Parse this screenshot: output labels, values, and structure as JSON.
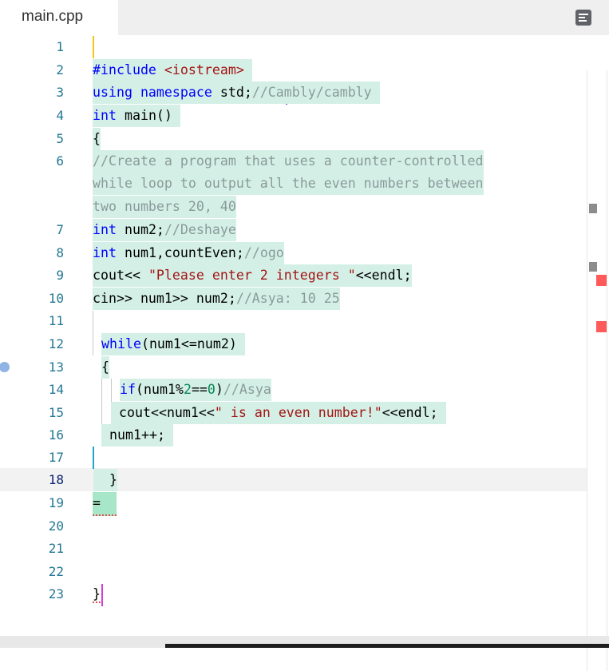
{
  "tab": {
    "title": "main.cpp"
  },
  "gutter": {
    "numbers": [
      "1",
      "2",
      "3",
      "4",
      "5",
      "6",
      "7",
      "8",
      "9",
      "10",
      "11",
      "12",
      "13",
      "14",
      "15",
      "16",
      "17",
      "18",
      "19",
      "20",
      "21",
      "22",
      "23"
    ],
    "active_line": "18"
  },
  "code": {
    "l2_a": "#include ",
    "l2_b": "<iostream>",
    "l3_a": "using namespace",
    "l3_b": " std;",
    "l3_c": "//Cambly/cambly",
    "l4_a": "int",
    "l4_b": " main()",
    "l5": "{",
    "l6_1": "//Create a program that uses a counter-controlled",
    "l6_2": "while loop to output all the even numbers between",
    "l6_3": "two numbers 20, 40",
    "l7_a": "int",
    "l7_b": " num2;",
    "l7_c": "//Deshaye",
    "l8_a": "int",
    "l8_b": " num1,countEven;",
    "l8_c": "//ogo",
    "l9_a": "cout<< ",
    "l9_b": "\"Please enter 2 integers \"",
    "l9_c": "<<endl;",
    "l10_a": "cin>> num1>> num2;",
    "l10_b": "//Asya: 10 25",
    "l12_a": "while",
    "l12_b": "(num1<=num2)",
    "l13": "{",
    "l14_a": "if",
    "l14_b": "(num1%",
    "l14_c": "2",
    "l14_d": "==",
    "l14_e": "0",
    "l14_f": ")",
    "l14_g": "//Asya",
    "l15_a": "cout<<num1<<",
    "l15_b": "\" is an even number!\"",
    "l15_c": "<<endl;",
    "l16": "num1++;",
    "l18": "}",
    "l19": "=",
    "l23": "}"
  },
  "colors": {
    "highlight": "#d4f0e6",
    "keyword": "#0000ff",
    "string": "#a31515",
    "comment": "#8a9a9a",
    "number": "#098658",
    "cursor_yellow": "#f5c518",
    "cursor_purple": "#6a5acd",
    "cursor_cyan": "#22a6c9",
    "cursor_magenta": "#d63ad6",
    "error_mark": "#ff5a5a"
  },
  "icons": {
    "menu": "menu-lines-icon",
    "breakpoint": "breakpoint-dot-icon"
  }
}
